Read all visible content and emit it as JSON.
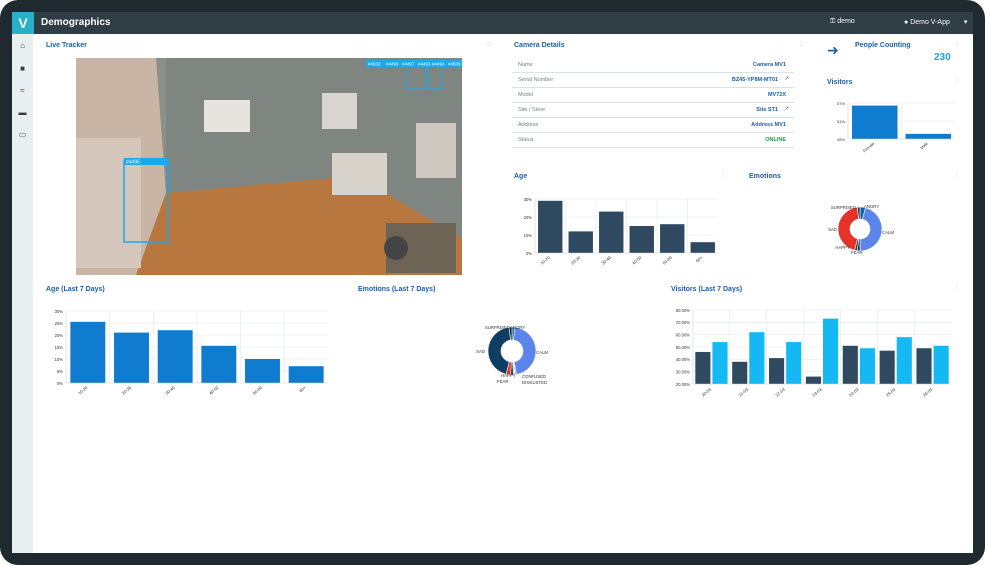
{
  "app": {
    "title": "Demographics",
    "user": "demo",
    "account": "Demo V-App",
    "logo_letter": "V"
  },
  "sidebar": {
    "items": [
      {
        "name": "home-icon",
        "glyph": "⌂"
      },
      {
        "name": "camera-icon",
        "glyph": "■"
      },
      {
        "name": "wifi-icon",
        "glyph": "≈"
      },
      {
        "name": "car-icon",
        "glyph": "▬"
      },
      {
        "name": "battery-icon",
        "glyph": "▭"
      }
    ]
  },
  "live_tracker": {
    "title": "Live Tracker",
    "track_ids": [
      "#4502",
      "#4496",
      "#4497",
      "#4493",
      "#4494",
      "#4509",
      "#4495"
    ]
  },
  "camera_details": {
    "title": "Camera Details",
    "rows": [
      {
        "label": "Name",
        "value": "Camera MV1"
      },
      {
        "label": "Serial Number",
        "value": "BZ45-YP8M-MT01"
      },
      {
        "label": "Model",
        "value": "MV72X"
      },
      {
        "label": "Site / Store",
        "value": "Site ST1"
      },
      {
        "label": "Address",
        "value": "Address MV1"
      },
      {
        "label": "Status",
        "value": "ONLINE"
      }
    ]
  },
  "people_counting": {
    "title": "People Counting",
    "value": "230"
  },
  "colors": {
    "accent": "#1ea0e8",
    "dark_bar": "#2f4a60",
    "blue_bar": "#0f7ccf",
    "light_bar": "#14b8f2",
    "red": "#e5332a",
    "title": "#1b5fa7"
  },
  "chart_data": [
    {
      "id": "visitors",
      "title": "Visitors",
      "type": "bar",
      "categories": [
        "Female",
        "Male"
      ],
      "values": [
        57,
        46
      ],
      "yticks": [
        "57%",
        "51%",
        "45%"
      ],
      "ylim": [
        44,
        58
      ]
    },
    {
      "id": "age",
      "title": "Age",
      "type": "bar",
      "categories": [
        "10-20",
        "20-30",
        "30-40",
        "40-50",
        "50-60",
        "60+"
      ],
      "values": [
        29,
        12,
        23,
        15,
        16,
        6
      ],
      "yticks": [
        "30%",
        "20%",
        "10%",
        "0%"
      ],
      "ylim": [
        0,
        30
      ]
    },
    {
      "id": "emotions",
      "title": "Emotions",
      "type": "pie",
      "labels": [
        "ANGRY",
        "CALM",
        "FEAR",
        "HAPPY",
        "SAD",
        "SURPRISED"
      ],
      "values": [
        4,
        46,
        2,
        2,
        44,
        2
      ]
    },
    {
      "id": "age7",
      "title": "Age (Last 7 Days)",
      "type": "bar",
      "categories": [
        "10-20",
        "20-30",
        "30-40",
        "40-50",
        "50-60",
        "60+"
      ],
      "values": [
        25.5,
        21,
        22,
        15.5,
        10,
        7
      ],
      "yticks": [
        "30%",
        "25%",
        "20%",
        "15%",
        "10%",
        "5%",
        "0%"
      ],
      "ylim": [
        0,
        30
      ]
    },
    {
      "id": "emotions7",
      "title": "Emotions (Last 7 Days)",
      "type": "pie",
      "labels": [
        "ANGRY",
        "CALM",
        "CONFUSED",
        "DISGUSTED",
        "FEAR",
        "HAPPY",
        "SAD",
        "SURPRISED"
      ],
      "values": [
        2,
        45,
        1,
        1,
        2,
        3,
        44,
        2
      ]
    },
    {
      "id": "visitors7",
      "title": "Visitors (Last 7 Days)",
      "type": "bar",
      "categories": [
        "20-03",
        "21-03",
        "22-03",
        "23-03",
        "24-03",
        "25-03",
        "26-03"
      ],
      "series": [
        {
          "values": [
            46,
            38,
            41,
            26,
            51,
            47,
            49
          ]
        },
        {
          "values": [
            54,
            62,
            54,
            73,
            49,
            58,
            51
          ]
        }
      ],
      "yticks": [
        "80.00%",
        "70.00%",
        "60.00%",
        "50.00%",
        "40.00%",
        "30.00%",
        "20.00%"
      ],
      "ylim": [
        20,
        80
      ]
    }
  ]
}
